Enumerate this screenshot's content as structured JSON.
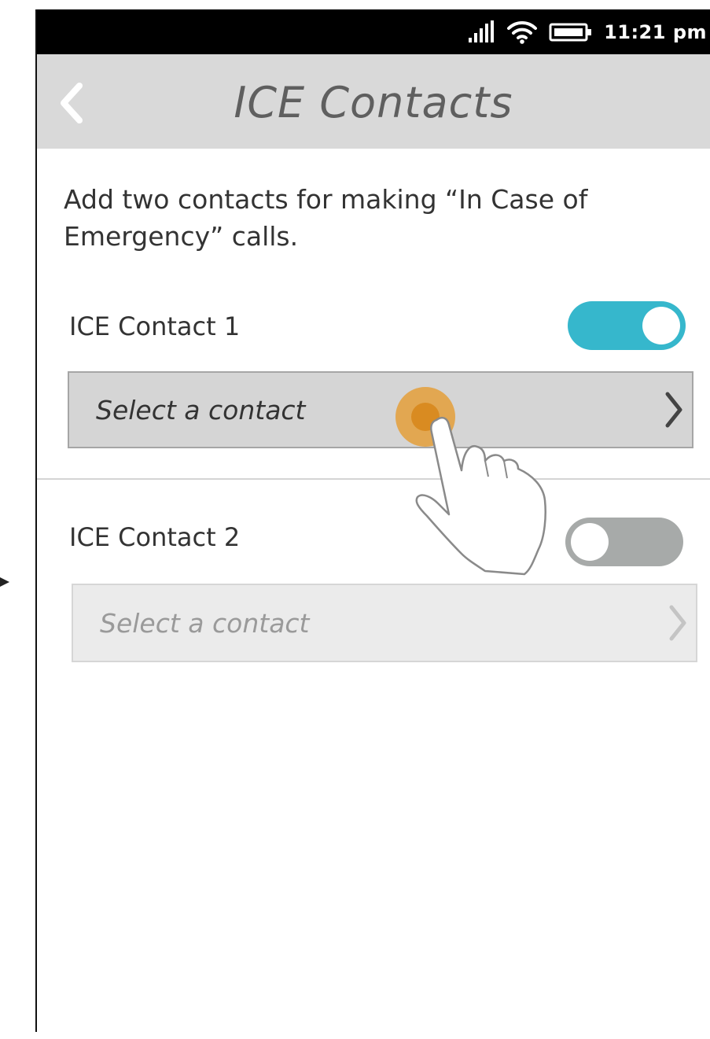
{
  "status_bar": {
    "time": "11:21 pm",
    "signal_icon": "signal-bars-icon",
    "wifi_icon": "wifi-icon",
    "battery_icon": "battery-icon"
  },
  "header": {
    "title": "ICE Contacts",
    "back_icon": "chevron-left-icon"
  },
  "intro_text": "Add two contacts for making “In Case of Emergency” calls.",
  "contacts": [
    {
      "label": "ICE Contact 1",
      "toggle_on": true,
      "placeholder": "Select a contact"
    },
    {
      "label": "ICE Contact 2",
      "toggle_on": false,
      "placeholder": "Select a contact"
    }
  ],
  "colors": {
    "toggle_on": "#36b7cc",
    "toggle_off": "#a7aaa9",
    "header_bg": "#d9d9d9",
    "touch_indicator": "#e59a2b"
  },
  "annotation": {
    "icon": "tap-hand-icon"
  }
}
